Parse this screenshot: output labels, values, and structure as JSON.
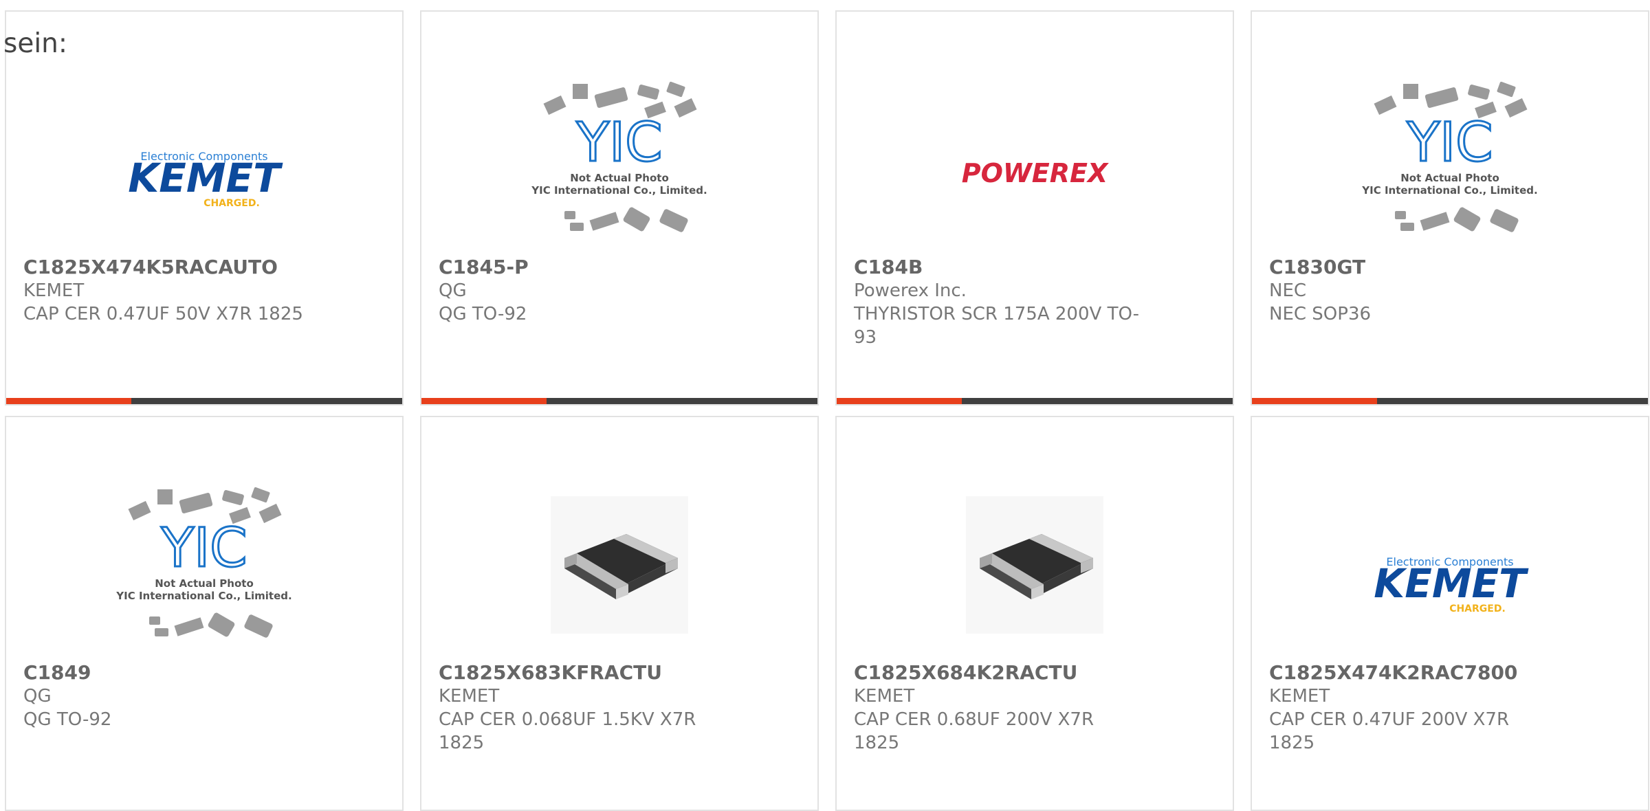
{
  "heading": "sein:",
  "colors": {
    "accent": "#e8401c",
    "bar": "#404040",
    "border": "#e2e2e2",
    "kemet_blue": "#0d4a9c",
    "kemet_yellow": "#f2b21b",
    "powerex_red": "#d7263d",
    "yic_blue": "#1a73c8"
  },
  "cards": [
    {
      "part_number": "C1825X474K5RACAUTO",
      "manufacturer": "KEMET",
      "description": "CAP CER 0.47UF 50V X7R 1825",
      "image": "kemet-logo"
    },
    {
      "part_number": "C1845-P",
      "manufacturer": "QG",
      "description": "QG TO-92",
      "image": "yic-placeholder"
    },
    {
      "part_number": "C184B",
      "manufacturer": "Powerex Inc.",
      "description": "THYRISTOR SCR 175A 200V TO-93",
      "image": "powerex-logo"
    },
    {
      "part_number": "C1830GT",
      "manufacturer": "NEC",
      "description": "NEC SOP36",
      "image": "yic-placeholder"
    },
    {
      "part_number": "C1849",
      "manufacturer": "QG",
      "description": "QG TO-92",
      "image": "yic-placeholder"
    },
    {
      "part_number": "C1825X683KFRACTU",
      "manufacturer": "KEMET",
      "description": "CAP CER 0.068UF 1.5KV X7R 1825",
      "image": "smd-capacitor-photo"
    },
    {
      "part_number": "C1825X684K2RACTU",
      "manufacturer": "KEMET",
      "description": "CAP CER 0.68UF 200V X7R 1825",
      "image": "smd-capacitor-photo"
    },
    {
      "part_number": "C1825X474K2RAC7800",
      "manufacturer": "KEMET",
      "description": "CAP CER 0.47UF 200V X7R 1825",
      "image": "kemet-logo"
    }
  ],
  "logo_text": {
    "kemet_tag": "Electronic Components",
    "kemet": "KEMET",
    "kemet_charged": "CHARGED.",
    "powerex": "POWEREX",
    "yic": "YIC",
    "yic_line1": "Not Actual Photo",
    "yic_line2": "YIC International Co., Limited."
  }
}
